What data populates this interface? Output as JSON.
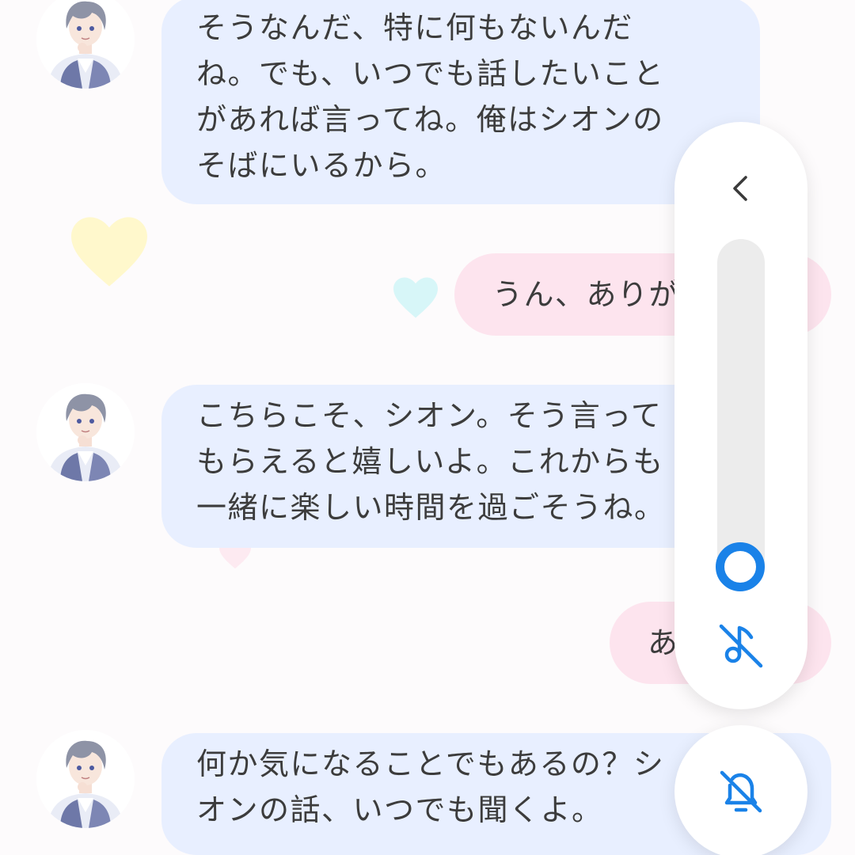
{
  "messages": [
    {
      "sender": "bot",
      "lines": [
        "そうなんだ、特に何もないんだ",
        "ね。でも、いつでも話したいこと",
        "があれば言ってね。俺はシオンの",
        "そばにいるから。"
      ]
    },
    {
      "sender": "user",
      "text": "うん、ありがとう"
    },
    {
      "sender": "bot",
      "lines": [
        "こちらこそ、シオン。そう言って",
        "もらえると嬉しいよ。これからも",
        "一緒に楽しい時間を過ごそうね。"
      ]
    },
    {
      "sender": "user",
      "text": "あ"
    },
    {
      "sender": "bot",
      "lines": [
        "何か気になることでもあるの？シ",
        "オンの話、いつでも聞くよ。"
      ]
    }
  ],
  "volume_panel": {
    "level": 0.05,
    "accent_color": "#1a82e8",
    "icons": {
      "collapse": "chevron-left-icon",
      "media": "music-note-off-icon",
      "ringer": "bell-off-icon"
    }
  },
  "colors": {
    "bot_bubble": "#e8efff",
    "user_bubble": "#fde4ee",
    "background": "#fdfbfc"
  }
}
